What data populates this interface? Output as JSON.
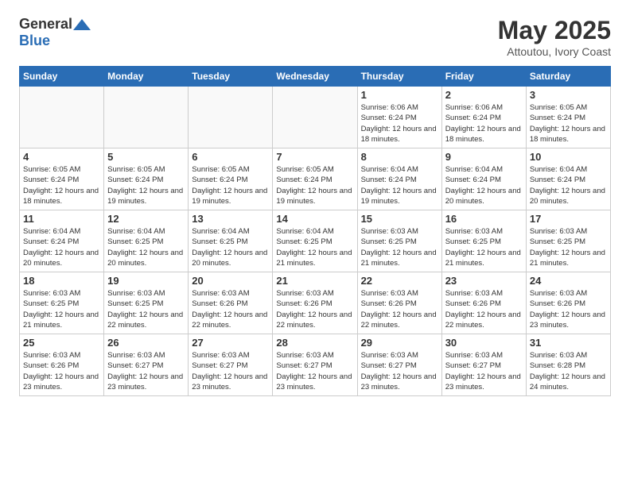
{
  "header": {
    "logo_general": "General",
    "logo_blue": "Blue",
    "title": "May 2025",
    "subtitle": "Attoutou, Ivory Coast"
  },
  "weekdays": [
    "Sunday",
    "Monday",
    "Tuesday",
    "Wednesday",
    "Thursday",
    "Friday",
    "Saturday"
  ],
  "weeks": [
    [
      {
        "day": "",
        "info": ""
      },
      {
        "day": "",
        "info": ""
      },
      {
        "day": "",
        "info": ""
      },
      {
        "day": "",
        "info": ""
      },
      {
        "day": "1",
        "info": "Sunrise: 6:06 AM\nSunset: 6:24 PM\nDaylight: 12 hours\nand 18 minutes."
      },
      {
        "day": "2",
        "info": "Sunrise: 6:06 AM\nSunset: 6:24 PM\nDaylight: 12 hours\nand 18 minutes."
      },
      {
        "day": "3",
        "info": "Sunrise: 6:05 AM\nSunset: 6:24 PM\nDaylight: 12 hours\nand 18 minutes."
      }
    ],
    [
      {
        "day": "4",
        "info": "Sunrise: 6:05 AM\nSunset: 6:24 PM\nDaylight: 12 hours\nand 18 minutes."
      },
      {
        "day": "5",
        "info": "Sunrise: 6:05 AM\nSunset: 6:24 PM\nDaylight: 12 hours\nand 19 minutes."
      },
      {
        "day": "6",
        "info": "Sunrise: 6:05 AM\nSunset: 6:24 PM\nDaylight: 12 hours\nand 19 minutes."
      },
      {
        "day": "7",
        "info": "Sunrise: 6:05 AM\nSunset: 6:24 PM\nDaylight: 12 hours\nand 19 minutes."
      },
      {
        "day": "8",
        "info": "Sunrise: 6:04 AM\nSunset: 6:24 PM\nDaylight: 12 hours\nand 19 minutes."
      },
      {
        "day": "9",
        "info": "Sunrise: 6:04 AM\nSunset: 6:24 PM\nDaylight: 12 hours\nand 20 minutes."
      },
      {
        "day": "10",
        "info": "Sunrise: 6:04 AM\nSunset: 6:24 PM\nDaylight: 12 hours\nand 20 minutes."
      }
    ],
    [
      {
        "day": "11",
        "info": "Sunrise: 6:04 AM\nSunset: 6:24 PM\nDaylight: 12 hours\nand 20 minutes."
      },
      {
        "day": "12",
        "info": "Sunrise: 6:04 AM\nSunset: 6:25 PM\nDaylight: 12 hours\nand 20 minutes."
      },
      {
        "day": "13",
        "info": "Sunrise: 6:04 AM\nSunset: 6:25 PM\nDaylight: 12 hours\nand 20 minutes."
      },
      {
        "day": "14",
        "info": "Sunrise: 6:04 AM\nSunset: 6:25 PM\nDaylight: 12 hours\nand 21 minutes."
      },
      {
        "day": "15",
        "info": "Sunrise: 6:03 AM\nSunset: 6:25 PM\nDaylight: 12 hours\nand 21 minutes."
      },
      {
        "day": "16",
        "info": "Sunrise: 6:03 AM\nSunset: 6:25 PM\nDaylight: 12 hours\nand 21 minutes."
      },
      {
        "day": "17",
        "info": "Sunrise: 6:03 AM\nSunset: 6:25 PM\nDaylight: 12 hours\nand 21 minutes."
      }
    ],
    [
      {
        "day": "18",
        "info": "Sunrise: 6:03 AM\nSunset: 6:25 PM\nDaylight: 12 hours\nand 21 minutes."
      },
      {
        "day": "19",
        "info": "Sunrise: 6:03 AM\nSunset: 6:25 PM\nDaylight: 12 hours\nand 22 minutes."
      },
      {
        "day": "20",
        "info": "Sunrise: 6:03 AM\nSunset: 6:26 PM\nDaylight: 12 hours\nand 22 minutes."
      },
      {
        "day": "21",
        "info": "Sunrise: 6:03 AM\nSunset: 6:26 PM\nDaylight: 12 hours\nand 22 minutes."
      },
      {
        "day": "22",
        "info": "Sunrise: 6:03 AM\nSunset: 6:26 PM\nDaylight: 12 hours\nand 22 minutes."
      },
      {
        "day": "23",
        "info": "Sunrise: 6:03 AM\nSunset: 6:26 PM\nDaylight: 12 hours\nand 22 minutes."
      },
      {
        "day": "24",
        "info": "Sunrise: 6:03 AM\nSunset: 6:26 PM\nDaylight: 12 hours\nand 23 minutes."
      }
    ],
    [
      {
        "day": "25",
        "info": "Sunrise: 6:03 AM\nSunset: 6:26 PM\nDaylight: 12 hours\nand 23 minutes."
      },
      {
        "day": "26",
        "info": "Sunrise: 6:03 AM\nSunset: 6:27 PM\nDaylight: 12 hours\nand 23 minutes."
      },
      {
        "day": "27",
        "info": "Sunrise: 6:03 AM\nSunset: 6:27 PM\nDaylight: 12 hours\nand 23 minutes."
      },
      {
        "day": "28",
        "info": "Sunrise: 6:03 AM\nSunset: 6:27 PM\nDaylight: 12 hours\nand 23 minutes."
      },
      {
        "day": "29",
        "info": "Sunrise: 6:03 AM\nSunset: 6:27 PM\nDaylight: 12 hours\nand 23 minutes."
      },
      {
        "day": "30",
        "info": "Sunrise: 6:03 AM\nSunset: 6:27 PM\nDaylight: 12 hours\nand 23 minutes."
      },
      {
        "day": "31",
        "info": "Sunrise: 6:03 AM\nSunset: 6:28 PM\nDaylight: 12 hours\nand 24 minutes."
      }
    ]
  ]
}
